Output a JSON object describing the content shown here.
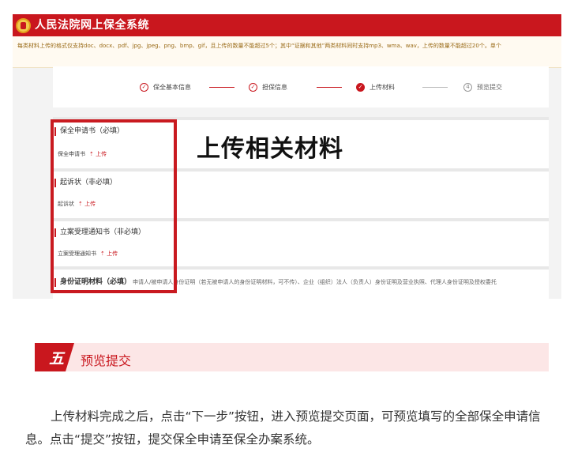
{
  "app": {
    "title": "人民法院网上保全系统"
  },
  "notice": "每类材料上传的格式仅支持doc、docx、pdf、jpg、jpeg、png、bmp、gif，且上传的数量不能超过5个；其中“证据和其他”两类材料同时支持mp3、wma、wav，上传的数量不能超过20个。单个",
  "steps": [
    {
      "label": "保全基本信息",
      "icon": "check-icon",
      "state": "done"
    },
    {
      "label": "担保信息",
      "icon": "check-icon",
      "state": "done"
    },
    {
      "label": "上传材料",
      "icon": "check-icon",
      "state": "active"
    },
    {
      "label": "预览提交",
      "number": "4",
      "state": "pending"
    }
  ],
  "sections": [
    {
      "title": "保全申请书（必填）",
      "item": "保全申请书",
      "upload": "上传"
    },
    {
      "title": "起诉状（非必填）",
      "item": "起诉状",
      "upload": "上传"
    },
    {
      "title": "立案受理通知书（非必填）",
      "item": "立案受理通知书",
      "upload": "上传"
    },
    {
      "title": "身份证明材料（必填）",
      "desc": "申请人/被申请人身份证明（若无被申请人的身份证明材料，可不传）、企业（组织）法人（负责人）身份证明及营业执照、代理人身份证明及授权委托"
    }
  ],
  "overlay": {
    "title": "上传相关材料"
  },
  "banner": {
    "number": "五",
    "title": "预览提交"
  },
  "paragraph": "上传材料完成之后，点击“下一步”按钮，进入预览提交页面，可预览填写的全部保全申请信息。点击“提交”按钮，提交保全申请至保全办案系统。",
  "colors": {
    "brand_red": "#c9171e",
    "banner_bg": "#fce6e6",
    "notice_bg": "#fffaf1"
  }
}
